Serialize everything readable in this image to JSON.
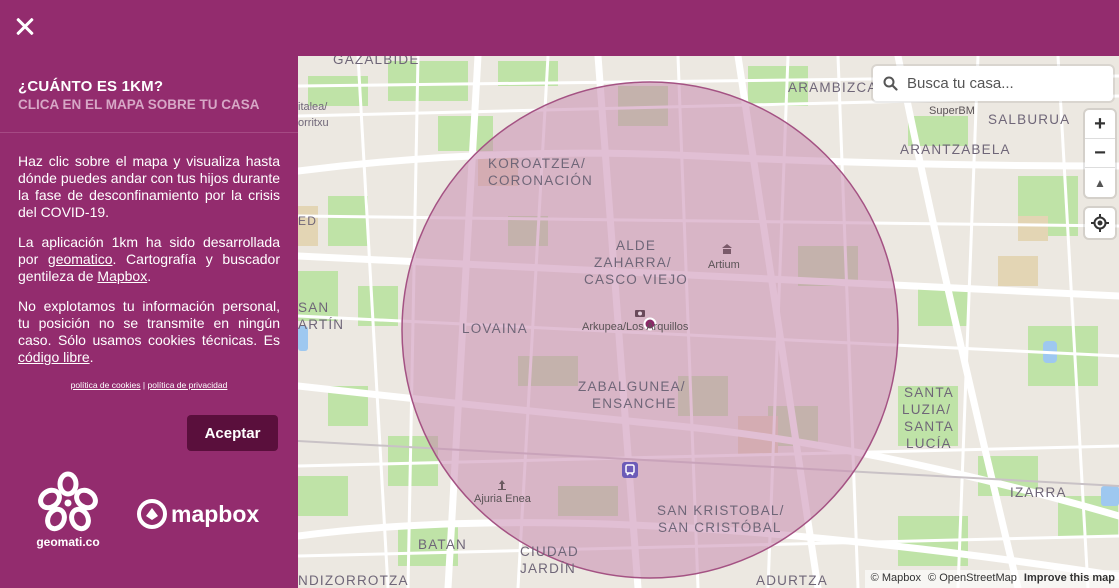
{
  "close_label": "×",
  "sidebar": {
    "title": "¿CUÁNTO ES 1KM?",
    "subtitle": "CLICA EN EL MAPA SOBRE TU CASA",
    "p1": "Haz clic sobre el mapa y visualiza hasta dónde puedes andar con tus hijos durante la fase de desconfinamiento por la crisis del COVID-19.",
    "p2_a": "La aplicación 1km ha sido desarrollada por ",
    "p2_link1": "geomatico",
    "p2_b": ". Cartografía y buscador gentileza de ",
    "p2_link2": "Mapbox",
    "p2_c": ".",
    "p3_a": "No explotamos tu información personal, tu posición no se transmite en ningún caso. Sólo usamos cookies técnicas. Es ",
    "p3_link": "código libre",
    "p3_b": ".",
    "cookies_link": "política de cookies",
    "separator": "|",
    "privacy_link": "política de privacidad",
    "accept_label": "Aceptar",
    "geo_logo_text": "geomati.co",
    "mapbox_logo_text": "mapbox",
    "brand_color": "#932c6e",
    "button_color": "#5a0f3c"
  },
  "search": {
    "placeholder": "Busca tu casa..."
  },
  "controls": {
    "zoom_in": "+",
    "zoom_out": "−",
    "compass": "▲"
  },
  "map": {
    "circle_color": "#c98bb0",
    "labels": {
      "gazalbide": "GAZALBIDE",
      "arambizca": "ARAMBIZCA",
      "salburua": "SALBURUA",
      "arantzabela": "ARANTZABELA",
      "koroatzea": "KOROATZEA/",
      "coronacion": "CORONACIÓN",
      "alde": "ALDE",
      "zaharra": "ZAHARRA/",
      "casco": "CASCO VIEJO",
      "lovaina": "LOVAINA",
      "zabalgunea": "ZABALGUNEA/",
      "ensanche": "ENSANCHE",
      "santa1": "SANTA",
      "santa2": "LUZIA/",
      "santa3": "SANTA",
      "santa4": "LUCÍA",
      "izarra": "IZARRA",
      "sankristobal1": "SAN KRISTOBAL/",
      "sankristobal2": "SAN CRISTÓBAL",
      "batan": "BATAN",
      "ciudad": "CIUDAD",
      "jardin": "JARDÍN",
      "mendizorrotza": "NDIZORROTZA",
      "adurtza": "ADURTZA",
      "san": "SAN",
      "martin": "ARTÍN",
      "ed": "ED",
      "sitalea1": "italea/",
      "sitalea2": "orritxu"
    },
    "pois": {
      "superbm": "SuperBM",
      "artium": "Artium",
      "arkupea": "Arkupea/Los Arquillos",
      "ajuria": "Ajuria Enea"
    }
  },
  "attribution": {
    "mapbox": "© Mapbox",
    "osm": "© OpenStreetMap",
    "improve": "Improve this map"
  }
}
